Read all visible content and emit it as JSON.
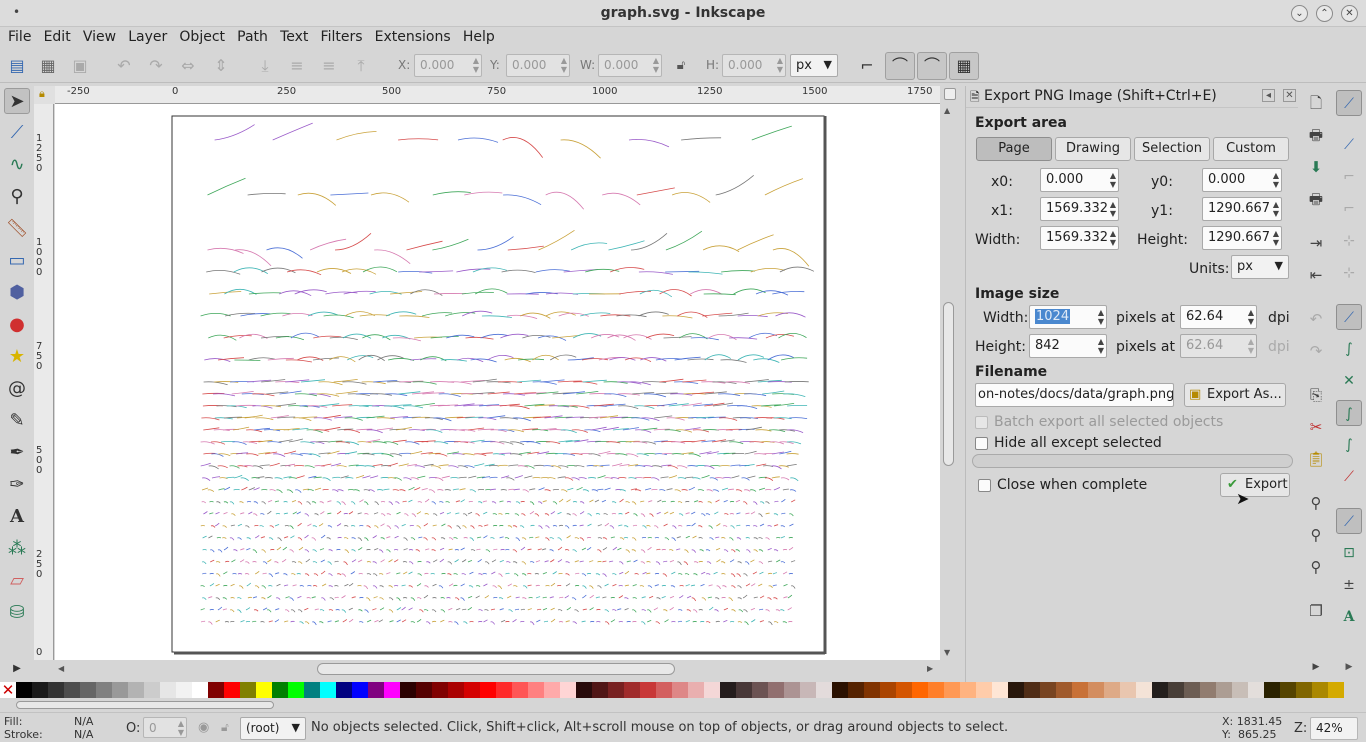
{
  "window": {
    "title": "graph.svg - Inkscape"
  },
  "menu": [
    "File",
    "Edit",
    "View",
    "Layer",
    "Object",
    "Path",
    "Text",
    "Filters",
    "Extensions",
    "Help"
  ],
  "toolbar": {
    "x_label": "X:",
    "x_value": "0.000",
    "y_label": "Y:",
    "y_value": "0.000",
    "w_label": "W:",
    "w_value": "0.000",
    "h_label": "H:",
    "h_value": "0.000",
    "unit": "px"
  },
  "ruler": {
    "h_ticks": [
      "-250",
      "0",
      "250",
      "500",
      "750",
      "1000",
      "1250",
      "1500",
      "1750"
    ],
    "v_ticks": [
      "1250",
      "1000",
      "750",
      "500",
      "250",
      "0"
    ]
  },
  "export_dialog": {
    "title": "Export PNG Image (Shift+Ctrl+E)",
    "area_heading": "Export area",
    "area_buttons": [
      "Page",
      "Drawing",
      "Selection",
      "Custom"
    ],
    "active_area": "Page",
    "x0_label": "x0:",
    "x0": "0.000",
    "y0_label": "y0:",
    "y0": "0.000",
    "x1_label": "x1:",
    "x1": "1569.332",
    "y1_label": "y1:",
    "y1": "1290.667",
    "width_label": "Width:",
    "width": "1569.332",
    "height_label": "Height:",
    "height": "1290.667",
    "units_label": "Units:",
    "units": "px",
    "size_heading": "Image size",
    "img_width_label": "Width:",
    "img_width": "1024",
    "img_height_label": "Height:",
    "img_height": "842",
    "pixels_at": "pixels at",
    "dpi_x": "62.64",
    "dpi_y": "62.64",
    "dpi_label": "dpi",
    "filename_heading": "Filename",
    "filename": "on-notes/docs/data/graph.png",
    "export_as": "Export As...",
    "batch_label": "Batch export all selected objects",
    "hide_label": "Hide all except selected",
    "close_label": "Close when complete",
    "export_button": "Export"
  },
  "status": {
    "fill_label": "Fill:",
    "fill_value": "N/A",
    "stroke_label": "Stroke:",
    "stroke_value": "N/A",
    "opacity_label": "O:",
    "opacity_value": "0",
    "layer": "(root)",
    "message": "No objects selected. Click, Shift+click, Alt+scroll mouse on top of objects, or drag around objects to select.",
    "x_coord": "X: 1831.45",
    "y_coord": "Y:  865.25",
    "zoom_label": "Z:",
    "zoom": "42%"
  },
  "colors": {
    "accent": "#5a8fd6",
    "select_hl": "#4a88cf"
  }
}
